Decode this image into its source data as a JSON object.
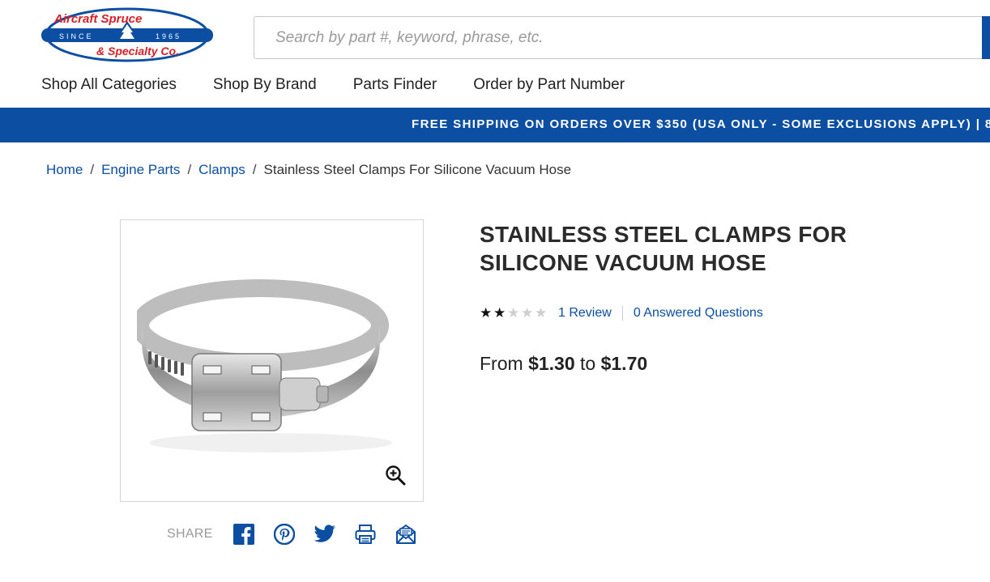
{
  "logo": {
    "line1": "Aircraft Spruce",
    "line2": "& Specialty Co.",
    "since_left": "SINCE",
    "since_right": "1965"
  },
  "search": {
    "placeholder": "Search by part #, keyword, phrase, etc.",
    "value": ""
  },
  "nav": {
    "items": [
      "Shop All Categories",
      "Shop By Brand",
      "Parts Finder",
      "Order by Part Number"
    ]
  },
  "banner": {
    "text": "FREE SHIPPING ON ORDERS OVER $350 (USA ONLY - SOME EXCLUSIONS APPLY) | 8"
  },
  "breadcrumb": {
    "items": [
      "Home",
      "Engine Parts",
      "Clamps"
    ],
    "current": "Stainless Steel Clamps For Silicone Vacuum Hose"
  },
  "product": {
    "title": "STAINLESS STEEL CLAMPS FOR SILICONE VACUUM HOSE",
    "rating": 2,
    "rating_max": 5,
    "reviews": "1 Review",
    "questions": "0 Answered Questions",
    "price_prefix": "From",
    "price_low": "$1.30",
    "price_join": "to",
    "price_high": "$1.70"
  },
  "share": {
    "label": "SHARE",
    "icons": [
      "facebook-icon",
      "pinterest-icon",
      "twitter-icon",
      "print-icon",
      "email-icon"
    ]
  },
  "colors": {
    "brand_blue": "#0b4ea2",
    "logo_red": "#d62027"
  }
}
